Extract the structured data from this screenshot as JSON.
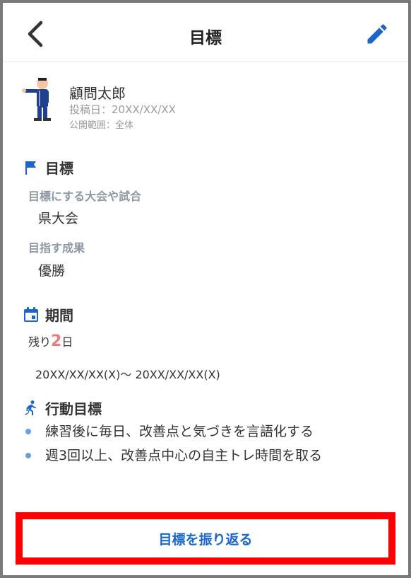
{
  "header": {
    "title": "目標",
    "back_icon": "chevron-left-icon",
    "edit_icon": "pencil-icon"
  },
  "profile": {
    "name": "顧問太郎",
    "post_date": "投稿日：20XX/XX/XX",
    "visibility": "公開範囲：全体"
  },
  "goal_section": {
    "title": "目標",
    "icon": "flag-icon",
    "target_event_label": "目標にする大会や試合",
    "target_event_value": "県大会",
    "aim_label": "目指す成果",
    "aim_value": "優勝"
  },
  "period_section": {
    "title": "期間",
    "icon": "calendar-icon",
    "remaining_prefix": "残り",
    "remaining_days": "2",
    "remaining_suffix": "日",
    "range": "20XX/XX/XX(X)〜 20XX/XX/XX(X)"
  },
  "action_section": {
    "title": "行動目標",
    "icon": "running-person-icon",
    "items": [
      "練習後に毎日、改善点と気づきを言語化する",
      "週3回以上、改善点中心の自主トレ時間を取る"
    ]
  },
  "footer": {
    "review_label": "目標を振り返る"
  },
  "colors": {
    "accent": "#1a66c9",
    "highlight": "#ff0000",
    "days": "#f07a7a",
    "label": "#8c98a4"
  }
}
